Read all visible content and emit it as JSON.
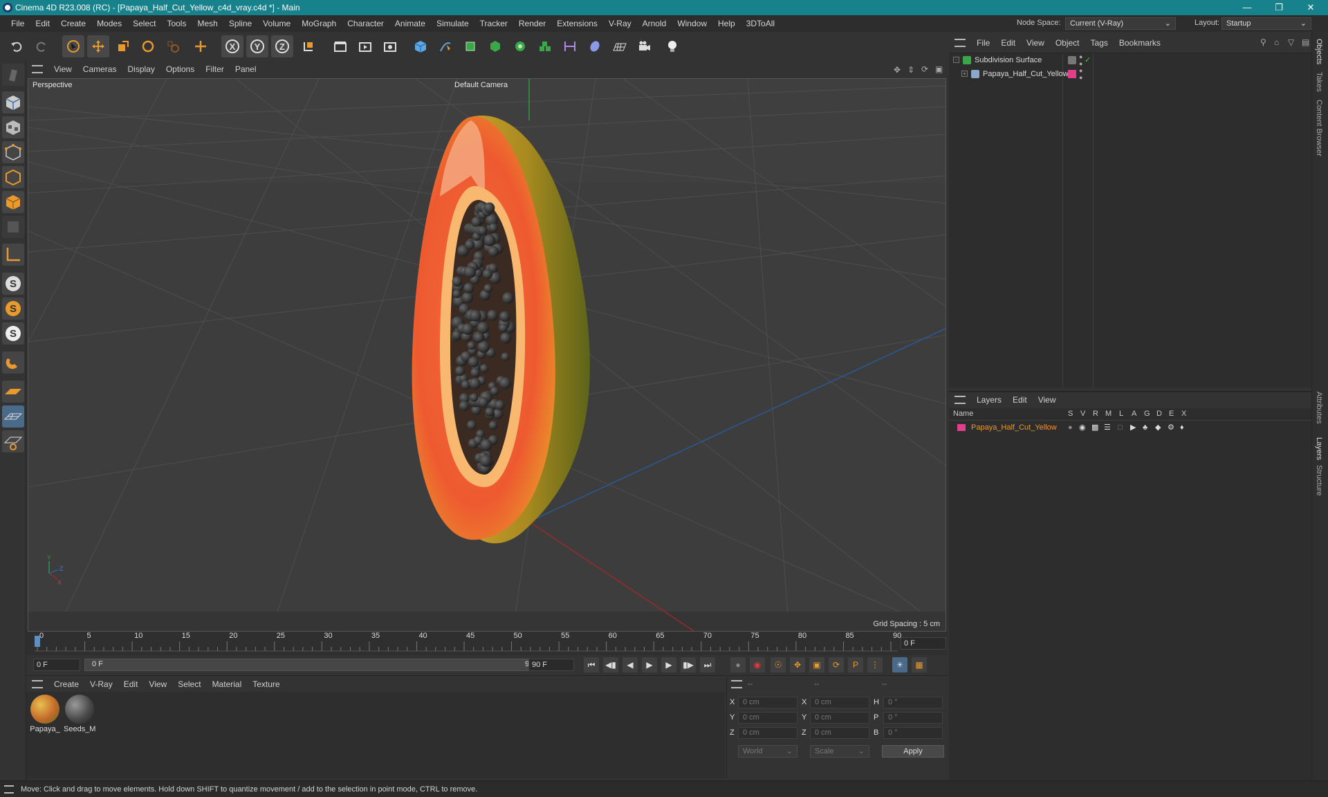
{
  "window": {
    "title": "Cinema 4D R23.008 (RC) - [Papaya_Half_Cut_Yellow_c4d_vray.c4d *] - Main"
  },
  "menu": [
    "File",
    "Edit",
    "Create",
    "Modes",
    "Select",
    "Tools",
    "Mesh",
    "Spline",
    "Volume",
    "MoGraph",
    "Character",
    "Animate",
    "Simulate",
    "Tracker",
    "Render",
    "Extensions",
    "V-Ray",
    "Arnold",
    "Window",
    "Help",
    "3DToAll"
  ],
  "nodespace": {
    "label": "Node Space:",
    "value": "Current (V-Ray)"
  },
  "layout": {
    "label": "Layout:",
    "value": "Startup"
  },
  "viewport": {
    "menu": [
      "View",
      "Cameras",
      "Display",
      "Options",
      "Filter",
      "Panel"
    ],
    "label": "Perspective",
    "camera": "Default Camera",
    "grid_spacing": "Grid Spacing : 5 cm"
  },
  "timeline": {
    "ticks": [
      "0",
      "5",
      "10",
      "15",
      "20",
      "25",
      "30",
      "35",
      "40",
      "45",
      "50",
      "55",
      "60",
      "65",
      "70",
      "75",
      "80",
      "85",
      "90"
    ],
    "current_frame": "0 F",
    "start_field": "0 F",
    "range_start": "0 F",
    "range_end": "90 F",
    "end_field": "90 F"
  },
  "materials": {
    "menu": [
      "Create",
      "V-Ray",
      "Edit",
      "View",
      "Select",
      "Material",
      "Texture"
    ],
    "items": [
      {
        "name": "Papaya_",
        "color": "#c46a2a"
      },
      {
        "name": "Seeds_M",
        "color": "#5a5a5a"
      }
    ]
  },
  "coords": {
    "headers": [
      "--",
      "--",
      "--"
    ],
    "rows": [
      {
        "a": "X",
        "av": "0 cm",
        "b": "X",
        "bv": "0 cm",
        "c": "H",
        "cv": "0 °"
      },
      {
        "a": "Y",
        "av": "0 cm",
        "b": "Y",
        "bv": "0 cm",
        "c": "P",
        "cv": "0 °"
      },
      {
        "a": "Z",
        "av": "0 cm",
        "b": "Z",
        "bv": "0 cm",
        "c": "B",
        "cv": "0 °"
      }
    ],
    "mode1": "World",
    "mode2": "Scale",
    "apply": "Apply"
  },
  "objects": {
    "menu": [
      "File",
      "Edit",
      "View",
      "Object",
      "Tags",
      "Bookmarks"
    ],
    "items": [
      "Subdivision Surface",
      "Papaya_Half_Cut_Yellow"
    ]
  },
  "layers": {
    "menu": [
      "Layers",
      "Edit",
      "View"
    ],
    "name_header": "Name",
    "cols": [
      "S",
      "V",
      "R",
      "M",
      "L",
      "A",
      "G",
      "D",
      "E",
      "X"
    ],
    "items": [
      {
        "name": "Papaya_Half_Cut_Yellow",
        "color": "#e0408a"
      }
    ]
  },
  "side_tabs": [
    "Objects",
    "Takes",
    "Content Browser",
    "Attributes",
    "Layers",
    "Structure"
  ],
  "status": "Move: Click and drag to move elements. Hold down SHIFT to quantize movement / add to the selection in point mode, CTRL to remove."
}
